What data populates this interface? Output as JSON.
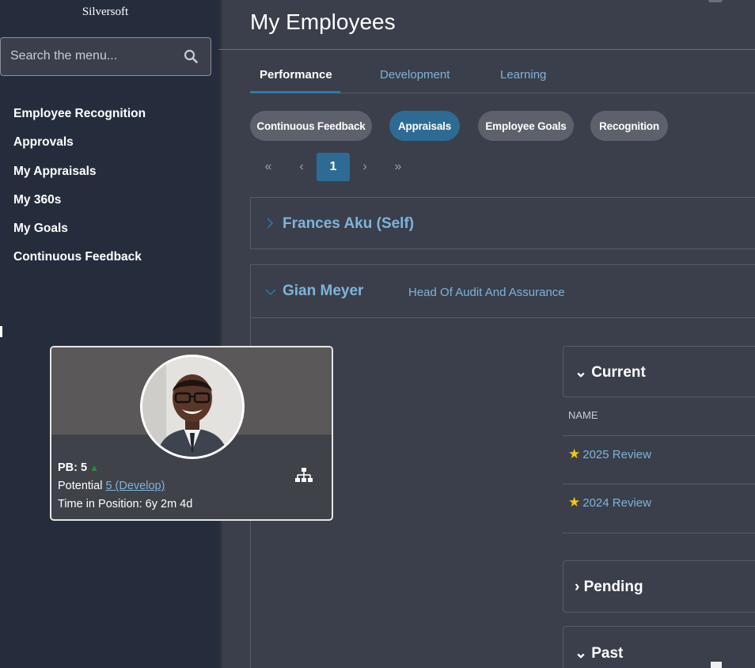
{
  "sidebar": {
    "brand": "Silversoft",
    "search_placeholder": "Search the menu...",
    "items": [
      {
        "label": "Employee Recognition"
      },
      {
        "label": "Approvals"
      },
      {
        "label": "My Appraisals"
      },
      {
        "label": "My 360s"
      },
      {
        "label": "My Goals"
      },
      {
        "label": "Continuous Feedback"
      }
    ]
  },
  "header": {
    "title": "My Employees"
  },
  "tabs": [
    {
      "label": "Performance",
      "active": true
    },
    {
      "label": "Development"
    },
    {
      "label": "Learning"
    }
  ],
  "filters": [
    {
      "label": "Continuous Feedback"
    },
    {
      "label": "Appraisals",
      "active": true
    },
    {
      "label": "Employee Goals"
    },
    {
      "label": "Recognition"
    }
  ],
  "pagination": {
    "current_page": "1",
    "first": "«",
    "prev": "‹",
    "next": "›",
    "last": "»"
  },
  "employees": [
    {
      "name": "Frances Aku (Self)",
      "expanded": false
    },
    {
      "name": "Gian Meyer",
      "role": "Head Of Audit And Assurance",
      "expanded": true
    }
  ],
  "card": {
    "pb_label": "PB: 5",
    "potential_label": "Potential",
    "potential_value": "5 (Develop)",
    "time_in_position": "Time in Position: 6y 2m 4d"
  },
  "reviews": {
    "current_title": "Current",
    "column_name": "NAME",
    "items": [
      {
        "label": "2025 Review"
      },
      {
        "label": "2024 Review"
      }
    ],
    "pending_title": "Pending",
    "past_title": "Past"
  },
  "colors": {
    "accent": "#2d6b94",
    "link": "#7fb3d9",
    "sidebar_bg": "#252d3d",
    "main_bg": "#3a3f4b",
    "star": "#f5c518"
  }
}
